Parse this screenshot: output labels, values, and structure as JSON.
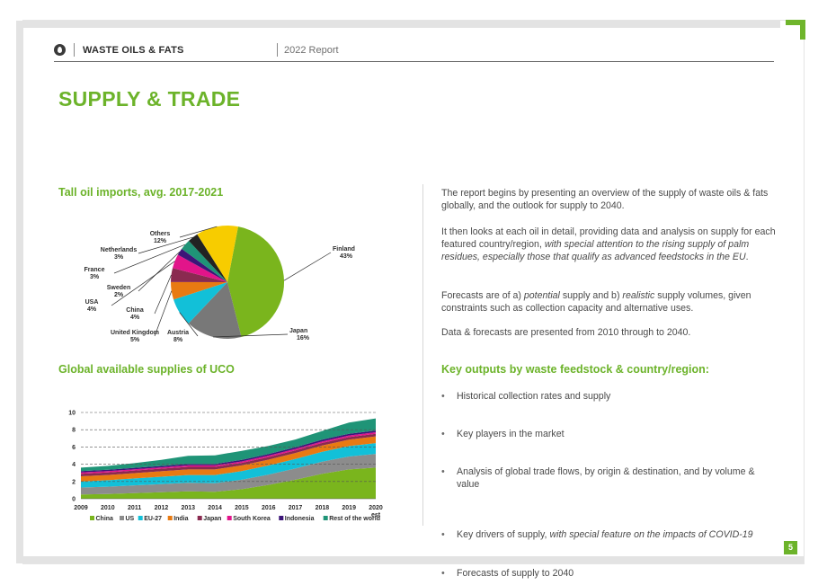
{
  "header": {
    "title": "WASTE OILS & FATS",
    "report": "2022 Report",
    "icon": "oil-drop-icon"
  },
  "page_title": "SUPPLY & TRADE",
  "pie_section_title": "Tall oil imports, avg. 2017-2021",
  "area_section_title": "Global available supplies of UCO",
  "right": {
    "paragraphs": [
      {
        "text": "The report begins by presenting an overview of the supply of waste oils & fats globally, and the outlook for supply to 2040."
      },
      {
        "text_plain": "It then looks at each oil in detail, providing data and analysis on supply for each featured country/region, ",
        "text_italic": "with special attention to the rising supply of palm residues, especially those that qualify as advanced feedstocks in the EU",
        "text_end": "."
      },
      {
        "a": "Forecasts are of a) ",
        "a_i": "potential",
        "b": " supply and b) ",
        "b_i": "realistic",
        "c": " supply volumes, given constraints such as collection capacity and alternative uses."
      },
      {
        "text": "Data & forecasts are  presented from 2010 through to 2040."
      }
    ],
    "outputs_title": "Key outputs by waste feedstock & country/region:",
    "bullets": [
      {
        "text": "Historical collection rates and supply"
      },
      {
        "text": "Key players in the market"
      },
      {
        "text": "Analysis of global trade flows, by origin & destination, and by volume & value"
      },
      {
        "text": "Key drivers of supply, ",
        "italic": "with special feature on the impacts of COVID-19"
      },
      {
        "text": "Forecasts of supply to 2040"
      }
    ]
  },
  "page_number": "5",
  "colors": {
    "accent": "#6cb32a",
    "frame": "#e3e3e3"
  },
  "chart_data": [
    {
      "type": "pie",
      "title": "Tall oil imports, avg. 2017-2021",
      "slices": [
        {
          "name": "Finland",
          "value": 43,
          "label": "43%",
          "color": "#7ab51d"
        },
        {
          "name": "Japan",
          "value": 16,
          "label": "16%",
          "color": "#787878"
        },
        {
          "name": "Austria",
          "value": 8,
          "label": "8%",
          "color": "#12c0d8"
        },
        {
          "name": "United Kingdom",
          "value": 5,
          "label": "5%",
          "color": "#e87a12"
        },
        {
          "name": "China",
          "value": 4,
          "label": "4%",
          "color": "#8a2a50"
        },
        {
          "name": "USA",
          "value": 4,
          "label": "4%",
          "color": "#e2148a"
        },
        {
          "name": "Sweden",
          "value": 2,
          "label": "2%",
          "color": "#3c1578"
        },
        {
          "name": "France",
          "value": 3,
          "label": "3%",
          "color": "#1f9477"
        },
        {
          "name": "Netherlands",
          "value": 3,
          "label": "3%",
          "color": "#222222"
        },
        {
          "name": "Others",
          "value": 12,
          "label": "12%",
          "color": "#f7cc00"
        }
      ]
    },
    {
      "type": "area",
      "title": "Global available supplies of UCO",
      "x": [
        "2009",
        "2010",
        "2011",
        "2012",
        "2013",
        "2014",
        "2015",
        "2016",
        "2017",
        "2018",
        "2019",
        "2020"
      ],
      "x_sublabel_last": "est",
      "ylim": [
        0,
        10
      ],
      "yticks": [
        0,
        2,
        4,
        6,
        8,
        10
      ],
      "grid": "dashed-horizontal",
      "legend_position": "bottom",
      "series": [
        {
          "name": "China",
          "color": "#7ab51d",
          "values": [
            0.5,
            0.55,
            0.65,
            0.75,
            0.85,
            0.8,
            1.1,
            1.6,
            2.2,
            2.9,
            3.4,
            3.6
          ]
        },
        {
          "name": "US",
          "color": "#8c8c8c",
          "values": [
            0.8,
            0.85,
            0.9,
            0.95,
            1.0,
            1.0,
            1.1,
            1.2,
            1.3,
            1.4,
            1.5,
            1.6
          ]
        },
        {
          "name": "EU-27",
          "color": "#12c0d8",
          "values": [
            0.7,
            0.75,
            0.8,
            0.85,
            0.9,
            0.95,
            1.0,
            1.05,
            1.1,
            1.15,
            1.2,
            1.25
          ]
        },
        {
          "name": "India",
          "color": "#e87a12",
          "values": [
            0.6,
            0.6,
            0.62,
            0.64,
            0.65,
            0.65,
            0.66,
            0.68,
            0.7,
            0.72,
            0.75,
            0.78
          ]
        },
        {
          "name": "Japan",
          "color": "#8a2a50",
          "values": [
            0.3,
            0.3,
            0.3,
            0.3,
            0.3,
            0.3,
            0.3,
            0.3,
            0.3,
            0.3,
            0.3,
            0.3
          ]
        },
        {
          "name": "South Korea",
          "color": "#e2148a",
          "values": [
            0.15,
            0.15,
            0.15,
            0.15,
            0.16,
            0.16,
            0.16,
            0.17,
            0.17,
            0.18,
            0.18,
            0.18
          ]
        },
        {
          "name": "Indonesia",
          "color": "#3c1578",
          "values": [
            0.15,
            0.15,
            0.16,
            0.16,
            0.17,
            0.17,
            0.18,
            0.18,
            0.19,
            0.2,
            0.2,
            0.2
          ]
        },
        {
          "name": "Rest of the world",
          "color": "#1f9477",
          "values": [
            0.4,
            0.45,
            0.55,
            0.7,
            0.95,
            1.0,
            1.05,
            0.95,
            0.9,
            1.0,
            1.3,
            1.4
          ]
        }
      ]
    }
  ]
}
